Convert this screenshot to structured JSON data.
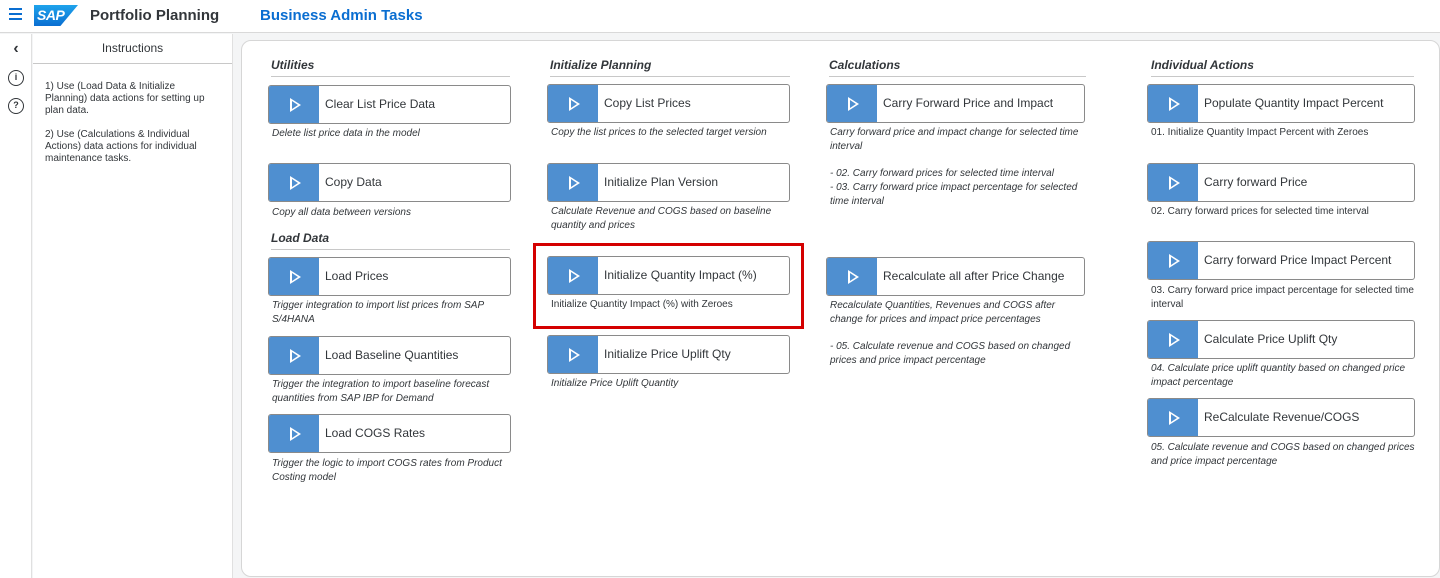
{
  "shell": {
    "logo_text": "SAP",
    "app_title": "Portfolio Planning",
    "page_title": "Business Admin Tasks"
  },
  "instructions": {
    "title": "Instructions",
    "lines": [
      "1) Use (Load Data & Initialize Planning) data actions for setting up plan data.",
      "2) Use (Calculations & Individual Actions) data actions for individual maintenance tasks."
    ]
  },
  "sections": {
    "utilities": "Utilities",
    "load_data": "Load Data",
    "initialize": "Initialize Planning",
    "calculations": "Calculations",
    "individual": "Individual Actions"
  },
  "actions": {
    "clear_list_price": {
      "label": "Clear List Price Data",
      "desc": "Delete list price data in the model"
    },
    "copy_data": {
      "label": "Copy Data",
      "desc": "Copy all data between versions"
    },
    "load_prices": {
      "label": "Load Prices",
      "desc": "Trigger integration to import list prices from SAP S/4HANA"
    },
    "load_baseline": {
      "label": "Load Baseline Quantities",
      "desc": "Trigger the integration to import baseline forecast quantities from SAP IBP for Demand"
    },
    "load_cogs": {
      "label": "Load COGS Rates",
      "desc": "Trigger the logic to import COGS rates from Product Costing model"
    },
    "copy_list_prices": {
      "label": "Copy List Prices",
      "desc": "Copy the list prices to the selected target version"
    },
    "init_plan_version": {
      "label": "Initialize Plan Version",
      "desc": "Calculate Revenue and COGS based on baseline quantity and prices"
    },
    "init_qty_impact": {
      "label": "Initialize Quantity Impact (%)",
      "desc": "Initialize Quantity Impact (%) with Zeroes"
    },
    "init_price_uplift": {
      "label": "Initialize Price Uplift Qty",
      "desc": "Initialize Price Uplift Quantity"
    },
    "carry_forward": {
      "label": "Carry Forward Price and Impact",
      "desc": "Carry forward price and impact change for selected time interval",
      "desc2": "- 02. Carry forward prices for selected time interval",
      "desc3": "- 03. Carry forward price impact percentage for selected time interval"
    },
    "recalc_all": {
      "label": "Recalculate all after Price Change",
      "desc": "Recalculate Quantities, Revenues and COGS after change for prices and impact price percentages",
      "desc2": "- 05. Calculate revenue and COGS based on changed prices and price impact percentage"
    },
    "populate_qty": {
      "label": "Populate Quantity Impact Percent",
      "desc": "01. Initialize Quantity Impact Percent with Zeroes"
    },
    "carry_price": {
      "label": "Carry forward Price",
      "desc": "02. Carry forward prices for selected time interval"
    },
    "carry_impact": {
      "label": "Carry forward Price Impact Percent",
      "desc": "03. Carry forward price impact percentage for selected time interval"
    },
    "calc_uplift": {
      "label": "Calculate Price Uplift Qty",
      "desc": "04. Calculate price uplift quantity based on changed price impact percentage"
    },
    "recalc_rev": {
      "label": "ReCalculate Revenue/COGS",
      "desc": "05. Calculate revenue and COGS based on changed prices and price impact percentage"
    }
  },
  "colors": {
    "accent": "#0a6ed1",
    "play_button": "#4f8fd0",
    "highlight": "#d40000"
  }
}
